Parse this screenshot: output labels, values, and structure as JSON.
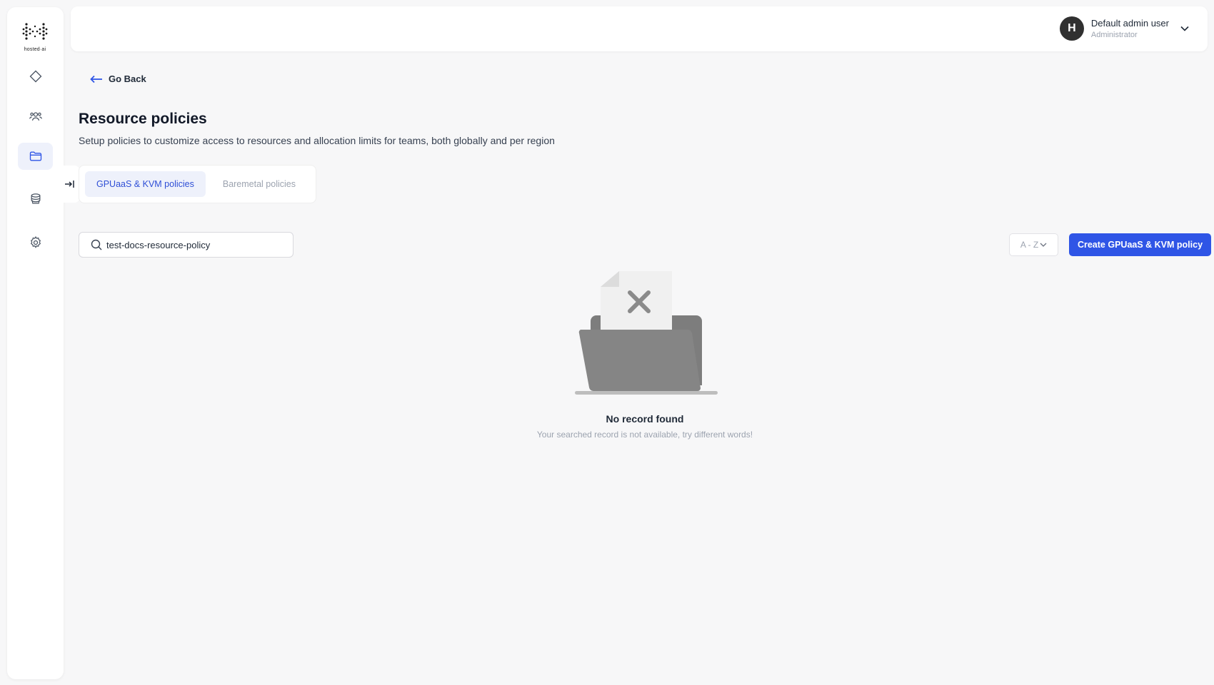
{
  "app": {
    "logo_text": "hosted·ai"
  },
  "sidebar": {
    "items": [
      {
        "icon": "diamond-icon"
      },
      {
        "icon": "users-icon"
      },
      {
        "icon": "folder-icon",
        "active": true
      },
      {
        "icon": "database-icon"
      },
      {
        "icon": "gear-icon"
      }
    ]
  },
  "header": {
    "user": {
      "initial": "H",
      "name": "Default admin user",
      "role": "Administrator"
    }
  },
  "nav": {
    "go_back": "Go Back"
  },
  "page": {
    "title": "Resource policies",
    "subtitle": "Setup policies to customize access to resources and allocation limits for teams, both globally and per region"
  },
  "tabs": [
    {
      "label": "GPUaaS & KVM policies",
      "active": true
    },
    {
      "label": "Baremetal policies",
      "active": false
    }
  ],
  "toolbar": {
    "search_value": "test-docs-resource-policy",
    "sort_label": "A - Z",
    "create_label": "Create GPUaaS & KVM policy"
  },
  "empty_state": {
    "title": "No record found",
    "subtitle": "Your searched record is not available, try different words!"
  },
  "colors": {
    "accent": "#2f55e6",
    "active_bg": "#eef1fb",
    "muted": "#9ca3af"
  }
}
